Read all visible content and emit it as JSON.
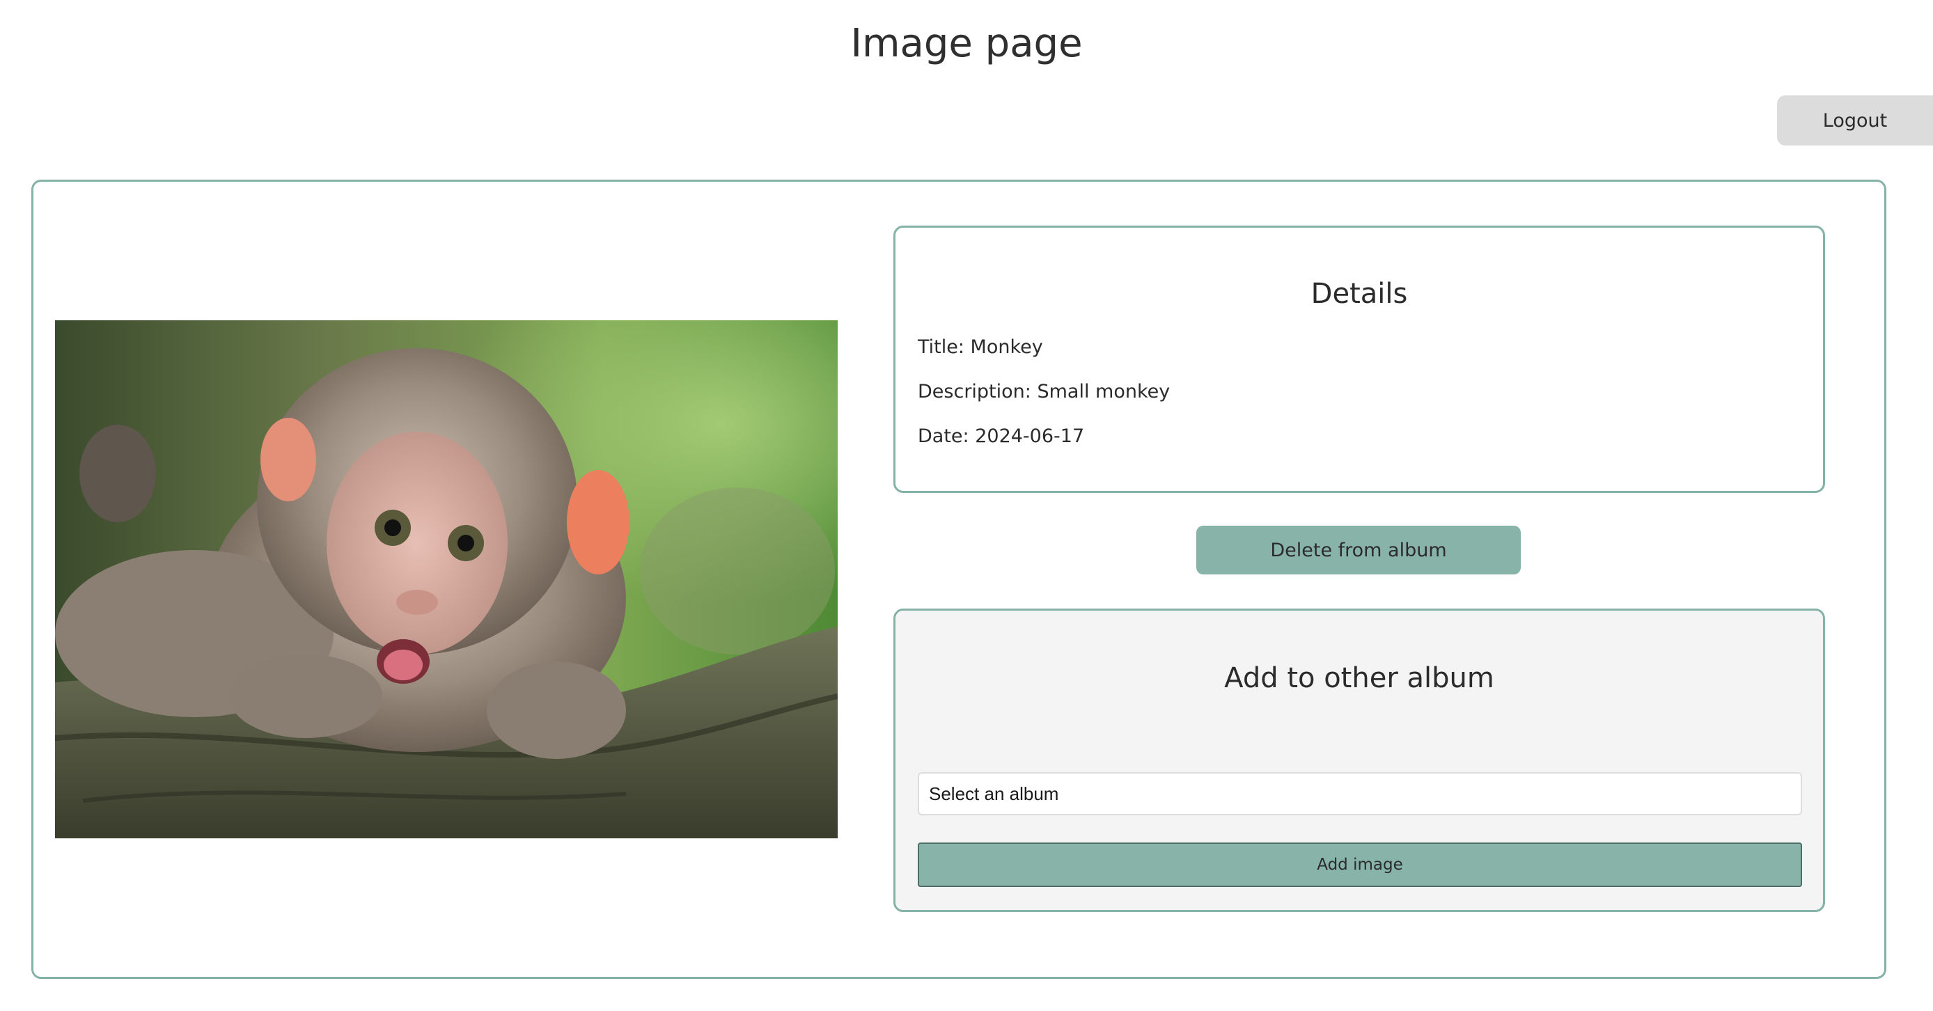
{
  "page": {
    "title": "Image page"
  },
  "header": {
    "logout_label": "Logout"
  },
  "image": {
    "subject": "monkey photo"
  },
  "details": {
    "heading": "Details",
    "title_line": "Title: Monkey",
    "description_line": "Description: Small monkey",
    "date_line": "Date: 2024-06-17"
  },
  "actions": {
    "delete_label": "Delete from album"
  },
  "add_album": {
    "heading": "Add to other album",
    "select_value": "Select an album",
    "add_button_label": "Add image"
  },
  "colors": {
    "accent": "#88b3a9",
    "border": "#86b1a6",
    "logout_bg": "#dcdcdc",
    "panel_bg": "#f4f4f4"
  }
}
